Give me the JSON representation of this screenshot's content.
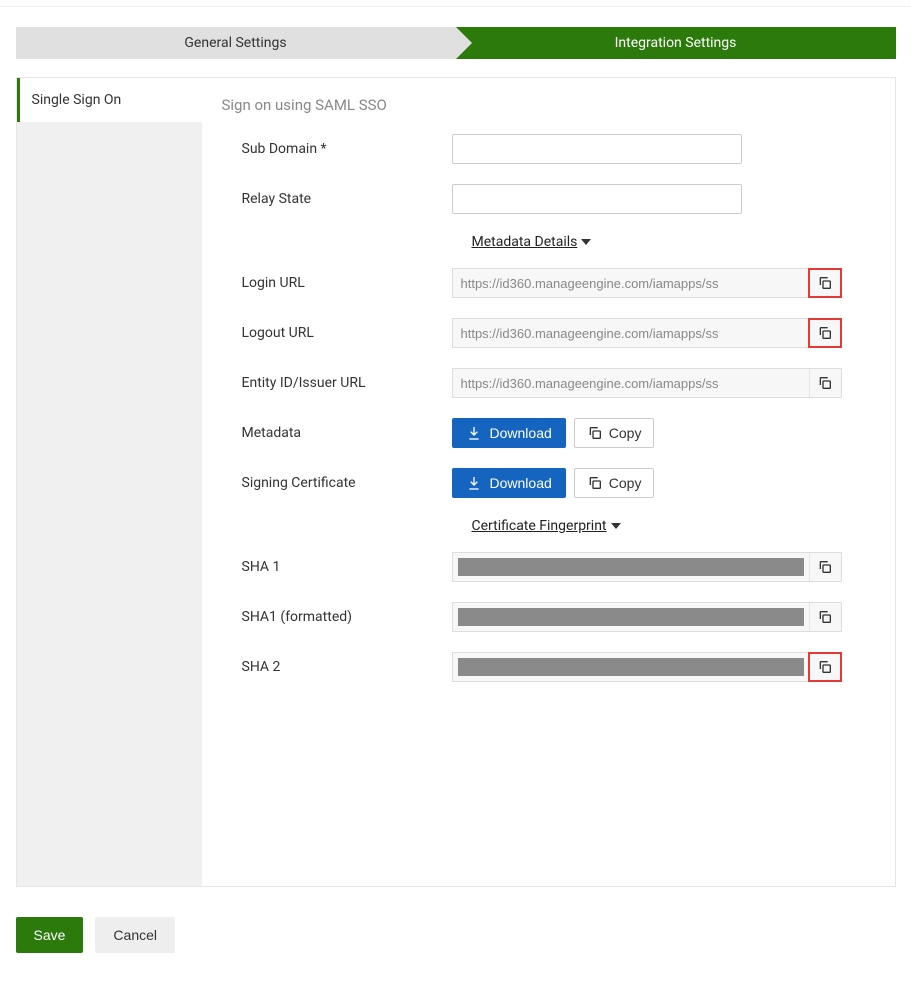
{
  "tabs": {
    "general": "General Settings",
    "integration": "Integration Settings"
  },
  "sidebar": {
    "items": [
      {
        "label": "Single Sign On"
      }
    ]
  },
  "section": {
    "title": "Sign on using SAML SSO",
    "sub_domain_label": "Sub Domain *",
    "relay_state_label": "Relay State",
    "metadata_details_label": "Metadata Details",
    "login_url_label": "Login URL",
    "login_url_value": "https://id360.manageengine.com/iamapps/ss",
    "logout_url_label": "Logout URL",
    "logout_url_value": "https://id360.manageengine.com/iamapps/ss",
    "entity_id_label": "Entity ID/Issuer URL",
    "entity_id_value": "https://id360.manageengine.com/iamapps/ss",
    "metadata_label": "Metadata",
    "signing_cert_label": "Signing Certificate",
    "cert_fingerprint_label": "Certificate Fingerprint",
    "sha1_label": "SHA 1",
    "sha1_formatted_label": "SHA1 (formatted)",
    "sha2_label": "SHA 2",
    "download_label": "Download",
    "copy_label": "Copy"
  },
  "footer": {
    "save": "Save",
    "cancel": "Cancel"
  }
}
